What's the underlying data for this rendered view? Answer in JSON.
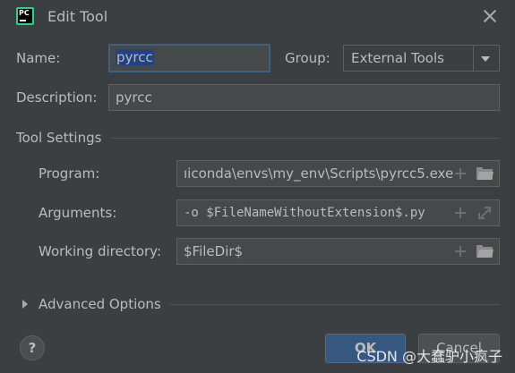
{
  "window": {
    "title": "Edit Tool"
  },
  "name": {
    "label": "Name:",
    "value": "pyrcc"
  },
  "group": {
    "label": "Group:",
    "value": "External Tools"
  },
  "description": {
    "label": "Description:",
    "value": "pyrcc"
  },
  "tool_settings": {
    "header": "Tool Settings",
    "program": {
      "label": "Program:",
      "value": "ıiconda\\envs\\my_env\\Scripts\\pyrcc5.exe"
    },
    "arguments": {
      "label": "Arguments:",
      "value": "-o $FileNameWithoutExtension$.py"
    },
    "working_directory": {
      "label": "Working directory:",
      "value": "$FileDir$"
    }
  },
  "advanced": {
    "label": "Advanced Options"
  },
  "footer": {
    "help": "?",
    "ok": "OK",
    "cancel": "Cancel"
  },
  "watermark": "CSDN @大蠢驴小疯子",
  "colors": {
    "background": "#3c3f41",
    "field_bg": "#45494a",
    "primary_button": "#365880",
    "focus_border": "#3d6185",
    "selection": "#214283"
  }
}
